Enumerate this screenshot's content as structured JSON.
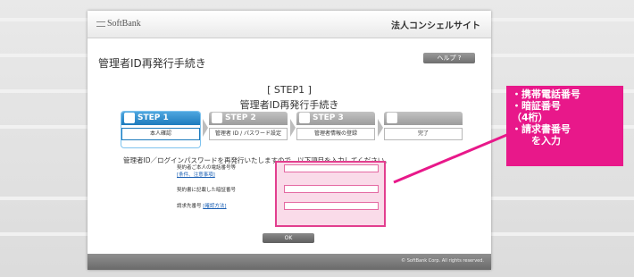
{
  "header": {
    "brand": "SoftBank",
    "site_title": "法人コンシェルサイト"
  },
  "page": {
    "title": "管理者ID再発行手続き",
    "help_label": "ヘルプ ?",
    "step_number": "[ STEP1 ]",
    "step_title": "管理者ID再発行手続き",
    "instruction": "管理者ID／ログインパスワードを再発行いたしますので、以下項目を入力してください。"
  },
  "steps": [
    {
      "label": "STEP 1",
      "sub": "本人確認"
    },
    {
      "label": "STEP 2",
      "sub": "管理者 ID / パスワード設定"
    },
    {
      "label": "STEP 3",
      "sub": "管理者情報の登録"
    },
    {
      "label": "",
      "sub": "完了"
    }
  ],
  "form": {
    "phone_label": "契約者ご本人の電話番号等",
    "phone_link": "[条件、注意事項]",
    "pin_label": "契約書に記載した暗証番号",
    "invoice_label": "請求先番号",
    "invoice_link": "[確認方法]",
    "phone_value": "",
    "pin_value": "",
    "invoice_value": "",
    "ok_label": "OK"
  },
  "footer": {
    "copyright": "© SoftBank Corp. All rights reserved."
  },
  "callout": {
    "lines": [
      "・携帯電話番号",
      "・暗証番号",
      "（4桁）",
      "・請求書番号",
      "　　を入力"
    ]
  },
  "colors": {
    "accent_blue": "#1d7bbd",
    "callout_pink": "#e8188a",
    "highlight_pink": "#e23f8f"
  }
}
